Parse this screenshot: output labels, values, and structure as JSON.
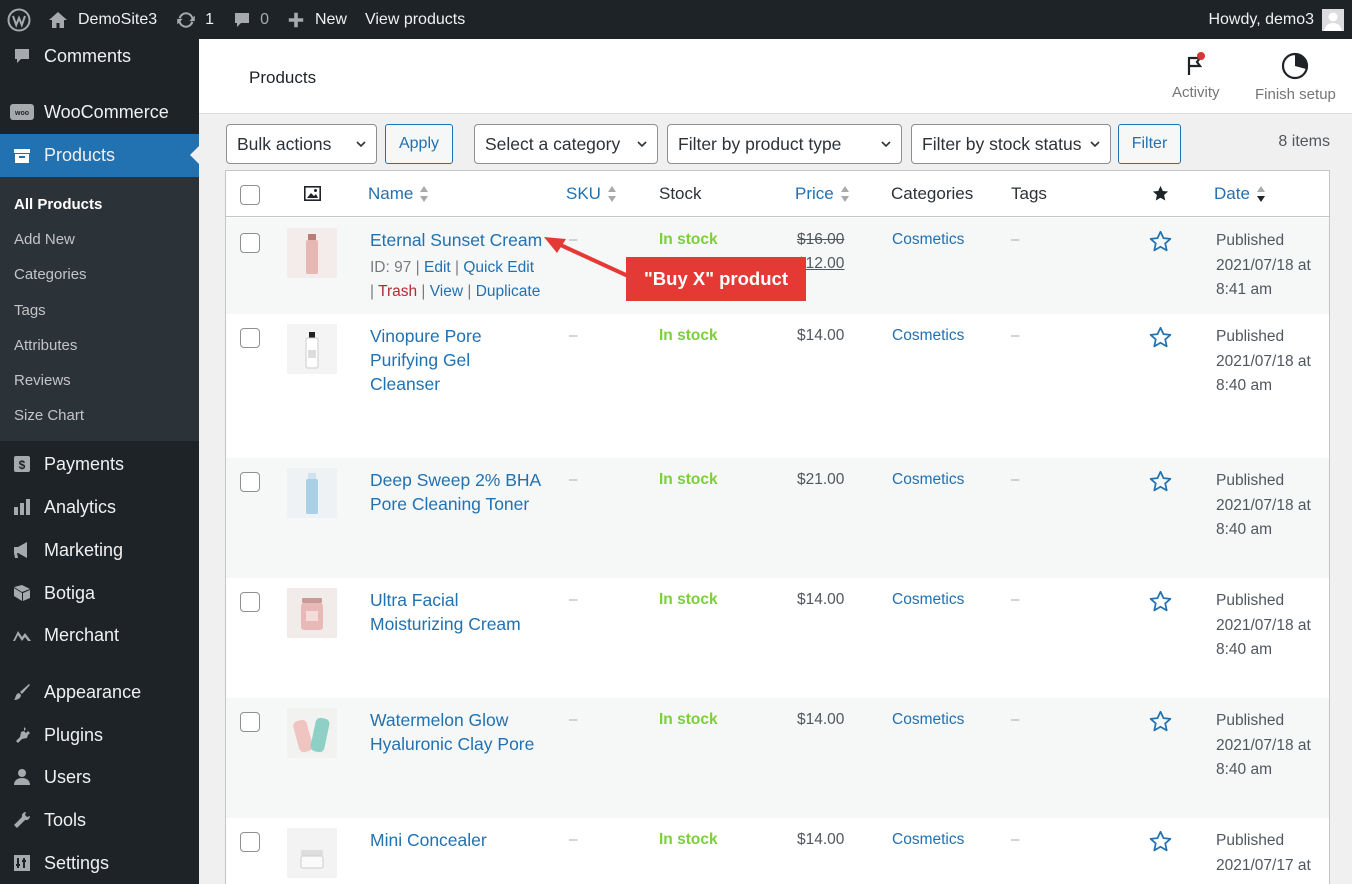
{
  "adminbar": {
    "site_name": "DemoSite3",
    "updates_count": "1",
    "comments_count": "0",
    "new_label": "New",
    "view_products": "View products",
    "greeting": "Howdy, demo3"
  },
  "sidebar": {
    "items": [
      {
        "label": "Comments",
        "icon": "comment-icon"
      },
      {
        "label": "WooCommerce",
        "icon": "woo-icon"
      },
      {
        "label": "Products",
        "icon": "archive-icon"
      },
      {
        "label": "Payments",
        "icon": "payments-icon"
      },
      {
        "label": "Analytics",
        "icon": "bar-chart-icon"
      },
      {
        "label": "Marketing",
        "icon": "megaphone-icon"
      },
      {
        "label": "Botiga",
        "icon": "botiga-icon"
      },
      {
        "label": "Merchant",
        "icon": "merchant-icon"
      },
      {
        "label": "Appearance",
        "icon": "brush-icon"
      },
      {
        "label": "Plugins",
        "icon": "plug-icon"
      },
      {
        "label": "Users",
        "icon": "user-icon"
      },
      {
        "label": "Tools",
        "icon": "wrench-icon"
      },
      {
        "label": "Settings",
        "icon": "settings-icon"
      }
    ],
    "submenu": [
      "All Products",
      "Add New",
      "Categories",
      "Tags",
      "Attributes",
      "Reviews",
      "Size Chart"
    ]
  },
  "header": {
    "title": "Products",
    "activity": "Activity",
    "finish_setup": "Finish setup"
  },
  "filters": {
    "bulk_actions": "Bulk actions",
    "apply": "Apply",
    "category": "Select a category",
    "product_type": "Filter by product type",
    "stock_status": "Filter by stock status",
    "filter": "Filter",
    "count": "8 items"
  },
  "table": {
    "columns": {
      "name": "Name",
      "sku": "SKU",
      "stock": "Stock",
      "price": "Price",
      "categories": "Categories",
      "tags": "Tags",
      "date": "Date"
    },
    "rows": [
      {
        "name": "Eternal Sunset Cream",
        "sku": "–",
        "stock": "In stock",
        "price_old": "$16.00",
        "price": "$12.00",
        "category": "Cosmetics",
        "tags": "–",
        "date_status": "Published",
        "date": "2021/07/18 at",
        "time": "8:41 am"
      },
      {
        "name_lines": [
          "Vinopure Pore",
          "Purifying Gel",
          "Cleanser"
        ],
        "sku": "–",
        "stock": "In stock",
        "price": "$14.00",
        "category": "Cosmetics",
        "tags": "–",
        "date_status": "Published",
        "date": "2021/07/18 at",
        "time": "8:40 am"
      },
      {
        "name_lines": [
          "Deep Sweep 2% BHA",
          "Pore Cleaning Toner"
        ],
        "sku": "–",
        "stock": "In stock",
        "price": "$21.00",
        "category": "Cosmetics",
        "tags": "–",
        "date_status": "Published",
        "date": "2021/07/18 at",
        "time": "8:40 am"
      },
      {
        "name_lines": [
          "Ultra Facial",
          "Moisturizing Cream"
        ],
        "sku": "–",
        "stock": "In stock",
        "price": "$14.00",
        "category": "Cosmetics",
        "tags": "–",
        "date_status": "Published",
        "date": "2021/07/18 at",
        "time": "8:40 am"
      },
      {
        "name_lines": [
          "Watermelon Glow",
          "Hyaluronic Clay Pore"
        ],
        "sku": "–",
        "stock": "In stock",
        "price": "$14.00",
        "category": "Cosmetics",
        "tags": "–",
        "date_status": "Published",
        "date": "2021/07/18 at",
        "time": "8:40 am"
      },
      {
        "name_lines": [
          "Mini Concealer"
        ],
        "sku": "–",
        "stock": "In stock",
        "price": "$14.00",
        "category": "Cosmetics",
        "tags": "–",
        "date_status": "Published",
        "date": "2021/07/17 at",
        "time": ""
      }
    ],
    "row_actions": {
      "id": "ID: 97",
      "edit": "Edit",
      "quick_edit": "Quick Edit",
      "trash": "Trash",
      "view": "View",
      "duplicate": "Duplicate"
    }
  },
  "callout": "\"Buy X\" product",
  "colors": {
    "accent": "#2271b1",
    "in_stock": "#7ad03a",
    "callout": "#e53935",
    "sidebar": "#1d2327"
  }
}
